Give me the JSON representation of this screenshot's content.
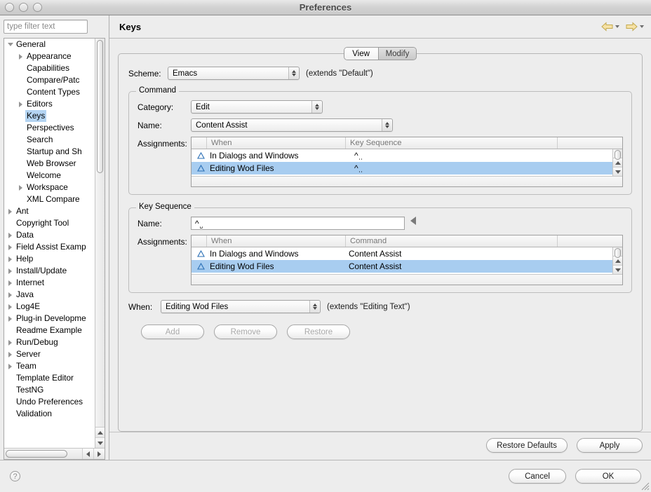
{
  "window": {
    "title": "Preferences",
    "traffic_lights": [
      "close",
      "minimize",
      "zoom"
    ]
  },
  "sidebar": {
    "filter_placeholder": "type filter text",
    "filter_value": "",
    "items": [
      {
        "label": "General",
        "depth": 0,
        "twisty": "down",
        "selected": false
      },
      {
        "label": "Appearance",
        "depth": 1,
        "twisty": "right",
        "selected": false
      },
      {
        "label": "Capabilities",
        "depth": 1,
        "twisty": "none",
        "selected": false
      },
      {
        "label": "Compare/Patc",
        "depth": 1,
        "twisty": "none",
        "selected": false
      },
      {
        "label": "Content Types",
        "depth": 1,
        "twisty": "none",
        "selected": false
      },
      {
        "label": "Editors",
        "depth": 1,
        "twisty": "right",
        "selected": false
      },
      {
        "label": "Keys",
        "depth": 1,
        "twisty": "none",
        "selected": true
      },
      {
        "label": "Perspectives",
        "depth": 1,
        "twisty": "none",
        "selected": false
      },
      {
        "label": "Search",
        "depth": 1,
        "twisty": "none",
        "selected": false
      },
      {
        "label": "Startup and Sh",
        "depth": 1,
        "twisty": "none",
        "selected": false
      },
      {
        "label": "Web Browser",
        "depth": 1,
        "twisty": "none",
        "selected": false
      },
      {
        "label": "Welcome",
        "depth": 1,
        "twisty": "none",
        "selected": false
      },
      {
        "label": "Workspace",
        "depth": 1,
        "twisty": "right",
        "selected": false
      },
      {
        "label": "XML Compare",
        "depth": 1,
        "twisty": "none",
        "selected": false
      },
      {
        "label": "Ant",
        "depth": 0,
        "twisty": "right",
        "selected": false
      },
      {
        "label": "Copyright Tool",
        "depth": 0,
        "twisty": "none",
        "selected": false
      },
      {
        "label": "Data",
        "depth": 0,
        "twisty": "right",
        "selected": false
      },
      {
        "label": "Field Assist Examp",
        "depth": 0,
        "twisty": "right",
        "selected": false
      },
      {
        "label": "Help",
        "depth": 0,
        "twisty": "right",
        "selected": false
      },
      {
        "label": "Install/Update",
        "depth": 0,
        "twisty": "right",
        "selected": false
      },
      {
        "label": "Internet",
        "depth": 0,
        "twisty": "right",
        "selected": false
      },
      {
        "label": "Java",
        "depth": 0,
        "twisty": "right",
        "selected": false
      },
      {
        "label": "Log4E",
        "depth": 0,
        "twisty": "right",
        "selected": false
      },
      {
        "label": "Plug-in Developme",
        "depth": 0,
        "twisty": "right",
        "selected": false
      },
      {
        "label": "Readme Example",
        "depth": 0,
        "twisty": "none",
        "selected": false
      },
      {
        "label": "Run/Debug",
        "depth": 0,
        "twisty": "right",
        "selected": false
      },
      {
        "label": "Server",
        "depth": 0,
        "twisty": "right",
        "selected": false
      },
      {
        "label": "Team",
        "depth": 0,
        "twisty": "right",
        "selected": false
      },
      {
        "label": "Template Editor",
        "depth": 0,
        "twisty": "none",
        "selected": false
      },
      {
        "label": "TestNG",
        "depth": 0,
        "twisty": "none",
        "selected": false
      },
      {
        "label": "Undo Preferences",
        "depth": 0,
        "twisty": "none",
        "selected": false
      },
      {
        "label": "Validation",
        "depth": 0,
        "twisty": "none",
        "selected": false
      }
    ]
  },
  "page": {
    "title": "Keys",
    "nav_back": "back-arrow",
    "nav_forward": "forward-arrow"
  },
  "tabs": [
    {
      "label": "View",
      "active": true
    },
    {
      "label": "Modify",
      "active": false
    }
  ],
  "scheme": {
    "label": "Scheme:",
    "value": "Emacs",
    "extends": "(extends \"Default\")"
  },
  "command_group": {
    "title": "Command",
    "category_label": "Category:",
    "category_value": "Edit",
    "name_label": "Name:",
    "name_value": "Content Assist",
    "assignments_label": "Assignments:",
    "columns": [
      "When",
      "Key Sequence"
    ],
    "rows": [
      {
        "when": "In Dialogs and Windows",
        "key_sequence": "^␣",
        "selected": false,
        "icon": "warning-triangle"
      },
      {
        "when": "Editing Wod Files",
        "key_sequence": "^␣",
        "selected": true,
        "icon": "warning-triangle"
      }
    ]
  },
  "key_sequence_group": {
    "title": "Key Sequence",
    "name_label": "Name:",
    "name_value": "^␣",
    "assignments_label": "Assignments:",
    "columns": [
      "When",
      "Command"
    ],
    "rows": [
      {
        "when": "In Dialogs and Windows",
        "command": "Content Assist",
        "selected": false,
        "icon": "warning-triangle"
      },
      {
        "when": "Editing Wod Files",
        "command": "Content Assist",
        "selected": true,
        "icon": "warning-triangle"
      }
    ]
  },
  "when": {
    "label": "When:",
    "value": "Editing Wod Files",
    "extends": "(extends \"Editing Text\")"
  },
  "action_buttons": [
    {
      "label": "Add",
      "disabled": true
    },
    {
      "label": "Remove",
      "disabled": true
    },
    {
      "label": "Restore",
      "disabled": true
    }
  ],
  "page_footer_buttons": [
    {
      "label": "Restore Defaults",
      "disabled": false
    },
    {
      "label": "Apply",
      "disabled": false
    }
  ],
  "dialog_footer": {
    "help_icon": "?",
    "buttons": [
      {
        "label": "Cancel",
        "disabled": false
      },
      {
        "label": "OK",
        "disabled": false
      }
    ]
  },
  "colors": {
    "selection_blue": "#a8cdf0",
    "tree_selection_blue": "#b4d4f2",
    "window_bg": "#ededed",
    "nav_arrow": "#f3dfa0"
  }
}
